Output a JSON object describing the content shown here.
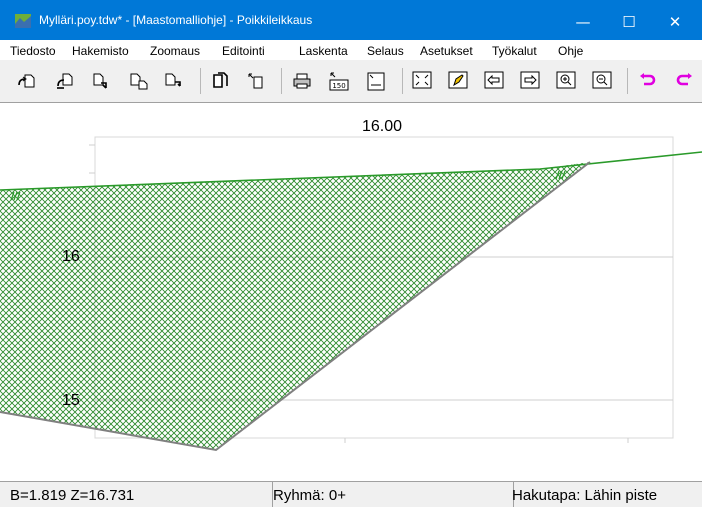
{
  "window": {
    "title": "Mylläri.poy.tdw* - [Maastomalliohje] - Poikkileikkaus",
    "minimize_symbol": "—",
    "maximize_symbol": "☐",
    "close_symbol": "✕"
  },
  "menu": [
    {
      "label": "Tiedosto"
    },
    {
      "label": "Hakemisto"
    },
    {
      "label": "Zoomaus"
    },
    {
      "label": "Editointi"
    },
    {
      "label": "Laskenta"
    },
    {
      "label": "Selaus"
    },
    {
      "label": "Asetukset"
    },
    {
      "label": "Työkalut"
    },
    {
      "label": "Ohje"
    }
  ],
  "toolbar": {
    "buttons": [
      {
        "icon": "open-icon"
      },
      {
        "icon": "open-folder-icon"
      },
      {
        "icon": "save-icon"
      },
      {
        "icon": "save-as-icon"
      },
      {
        "icon": "export-icon"
      },
      {
        "icon": "copy-icon"
      },
      {
        "icon": "window-icon"
      },
      {
        "icon": "print-icon"
      },
      {
        "icon": "scale-icon",
        "text": "150"
      },
      {
        "icon": "print-preview-icon"
      },
      {
        "icon": "zoom-extents-icon"
      },
      {
        "icon": "pencil-icon"
      },
      {
        "icon": "pan-left-icon"
      },
      {
        "icon": "pan-right-icon"
      },
      {
        "icon": "zoom-in-icon"
      },
      {
        "icon": "zoom-out-icon"
      },
      {
        "icon": "undo-icon"
      },
      {
        "icon": "redo-icon"
      }
    ]
  },
  "canvas": {
    "section_value": "16.00",
    "level_labels": {
      "upper": "16",
      "lower": "15"
    },
    "colors": {
      "fill": "#2e8b2e",
      "outline_top": "#2a9a2a",
      "outline_bottom": "#808080",
      "grid": "#cfcfcf",
      "undo_redo": "#e000e0"
    }
  },
  "status": {
    "coordinates": "B=1.819  Z=16.731",
    "group": "Ryhmä: 0+",
    "search_mode": "Hakutapa: Lähin piste"
  }
}
